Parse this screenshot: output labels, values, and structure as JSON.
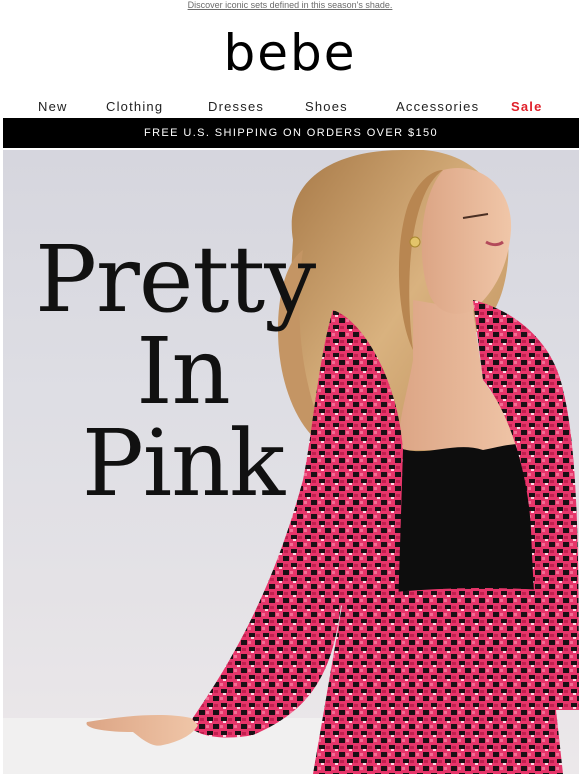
{
  "preheader": {
    "text": "Discover iconic sets defined in this season's shade."
  },
  "brand": {
    "logo": "bebe"
  },
  "nav": {
    "items": [
      {
        "label": "New"
      },
      {
        "label": "Clothing"
      },
      {
        "label": "Dresses"
      },
      {
        "label": "Shoes"
      },
      {
        "label": "Accessories"
      },
      {
        "label": "Sale",
        "color": "#e0202a"
      }
    ]
  },
  "banner": {
    "text": "FREE U.S. SHIPPING ON ORDERS OVER $150"
  },
  "hero": {
    "headline": [
      "Pretty",
      "In",
      "Pink"
    ],
    "colors": {
      "jacket": "#e6356a",
      "top": "#0d0d0d",
      "hair": "#c9a070",
      "skin": "#e9b899",
      "wall": "#dcdce2"
    }
  }
}
